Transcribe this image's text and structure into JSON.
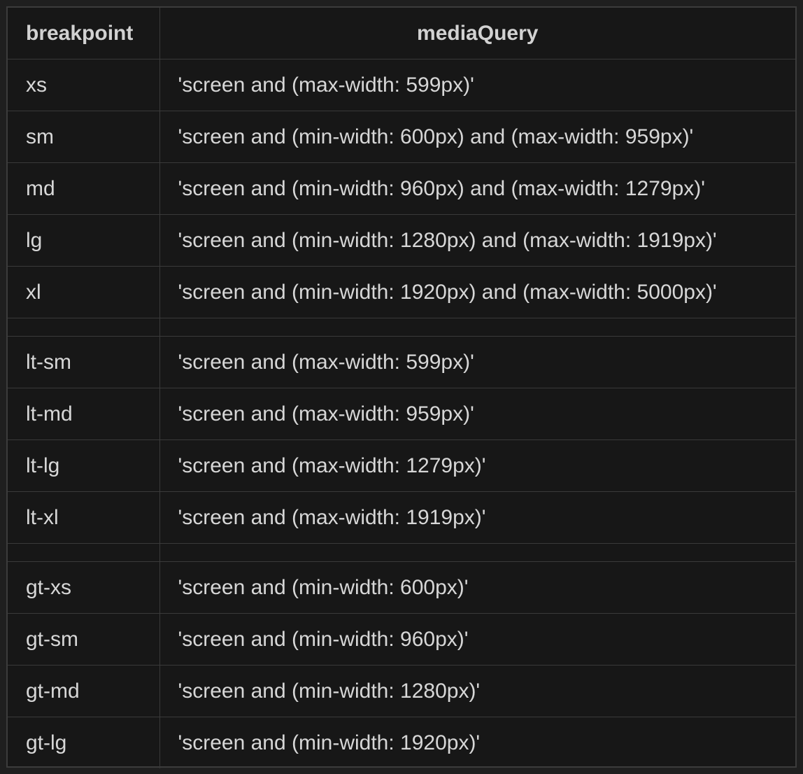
{
  "table": {
    "headers": [
      "breakpoint",
      "mediaQuery"
    ],
    "groups": [
      [
        [
          "xs",
          "'screen and (max-width: 599px)'"
        ],
        [
          "sm",
          "'screen and (min-width: 600px) and (max-width: 959px)'"
        ],
        [
          "md",
          "'screen and (min-width: 960px) and (max-width: 1279px)'"
        ],
        [
          "lg",
          "'screen and (min-width: 1280px) and (max-width: 1919px)'"
        ],
        [
          "xl",
          "'screen and (min-width: 1920px) and (max-width: 5000px)'"
        ]
      ],
      [
        [
          "lt-sm",
          "'screen and (max-width: 599px)'"
        ],
        [
          "lt-md",
          "'screen and (max-width: 959px)'"
        ],
        [
          "lt-lg",
          "'screen and (max-width: 1279px)'"
        ],
        [
          "lt-xl",
          "'screen and (max-width: 1919px)'"
        ]
      ],
      [
        [
          "gt-xs",
          "'screen and (min-width: 600px)'"
        ],
        [
          "gt-sm",
          "'screen and (min-width: 960px)'"
        ],
        [
          "gt-md",
          "'screen and (min-width: 1280px)'"
        ],
        [
          "gt-lg",
          "'screen and (min-width: 1920px)'"
        ]
      ]
    ]
  }
}
